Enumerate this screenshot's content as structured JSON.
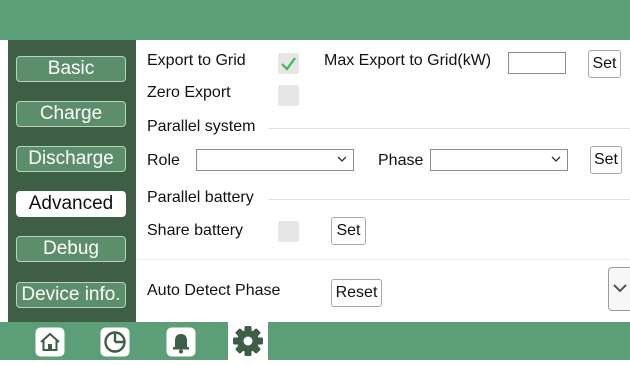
{
  "sidebar": {
    "items": [
      {
        "label": "Basic",
        "active": false
      },
      {
        "label": "Charge",
        "active": false
      },
      {
        "label": "Discharge",
        "active": false
      },
      {
        "label": "Advanced",
        "active": true
      },
      {
        "label": "Debug",
        "active": false
      },
      {
        "label": "Device info.",
        "active": false
      }
    ]
  },
  "export": {
    "export_to_grid_label": "Export to Grid",
    "export_to_grid_checked": true,
    "max_export_label": "Max Export to Grid(kW)",
    "max_export_value": "",
    "set_label": "Set",
    "zero_export_label": "Zero Export",
    "zero_export_checked": false
  },
  "parallel_system": {
    "section_label": "Parallel system",
    "role_label": "Role",
    "role_value": "",
    "phase_label": "Phase",
    "phase_value": "",
    "set_label": "Set"
  },
  "parallel_battery": {
    "section_label": "Parallel battery",
    "share_battery_label": "Share battery",
    "share_battery_checked": false,
    "set_label": "Set"
  },
  "auto_detect": {
    "label": "Auto Detect Phase",
    "reset_label": "Reset"
  },
  "bottom_nav": {
    "items": [
      {
        "icon": "home-icon",
        "active": false
      },
      {
        "icon": "pie-chart-icon",
        "active": false
      },
      {
        "icon": "bell-icon",
        "active": false
      },
      {
        "icon": "gear-icon",
        "active": true
      }
    ]
  },
  "colors": {
    "header_green": "#5b9e78",
    "sidebar_dark": "#3e5e46",
    "checkmark_green": "#3cb95a"
  }
}
